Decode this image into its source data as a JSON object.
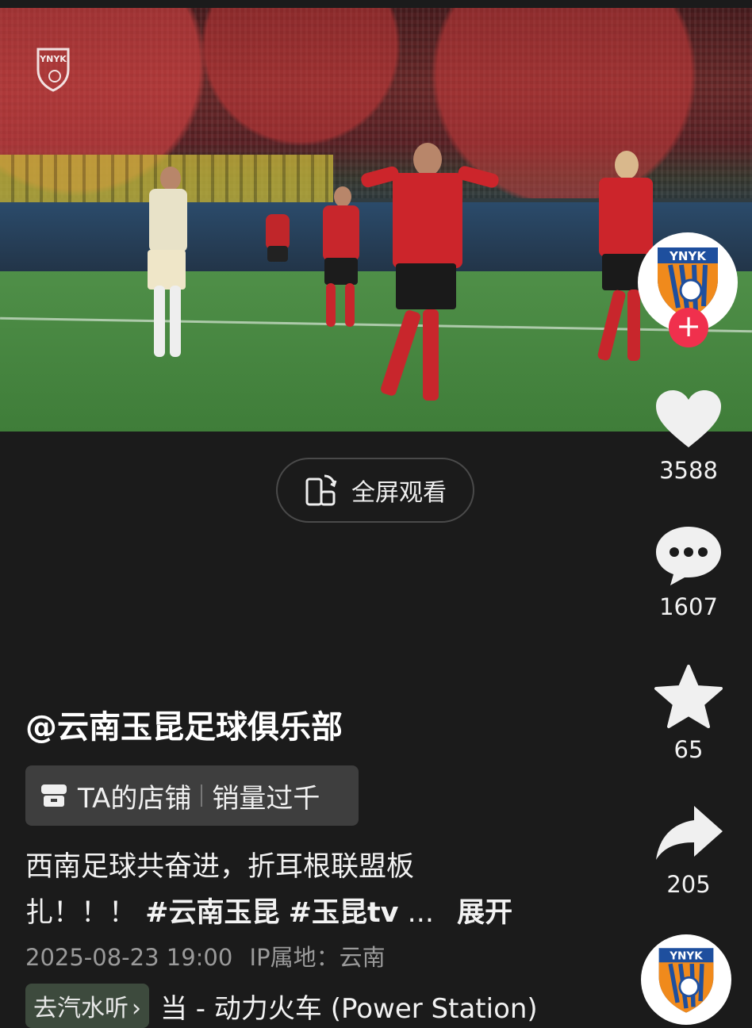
{
  "video": {
    "watermark": "YNYK"
  },
  "fullscreen": {
    "label": "全屏观看",
    "icon": "rotate-screen-icon"
  },
  "creator": {
    "avatar_text": "YNYK",
    "follow_symbol": "+"
  },
  "actions": {
    "likes": "3588",
    "comments": "1607",
    "favorites": "65",
    "shares": "205"
  },
  "post": {
    "account": "@云南玉昆足球俱乐部",
    "shop_label": "TA的店铺",
    "shop_sales": "销量过千",
    "description_line1": "西南足球共奋进，折耳根联盟板",
    "description_line2_prefix": "扎！！！",
    "hashtag1": "#云南玉昆",
    "hashtag2": "#玉昆tv",
    "ellipsis": "...",
    "expand_label": "展开",
    "timestamp": "2025-08-23 19:00",
    "ip_location": "IP属地：云南"
  },
  "music": {
    "listen_label": "去汽水听",
    "chevron": "›",
    "song": "当 - 动力火车 (Power Station)"
  },
  "colors": {
    "follow": "#f0304d",
    "background": "#1b1b1b"
  }
}
